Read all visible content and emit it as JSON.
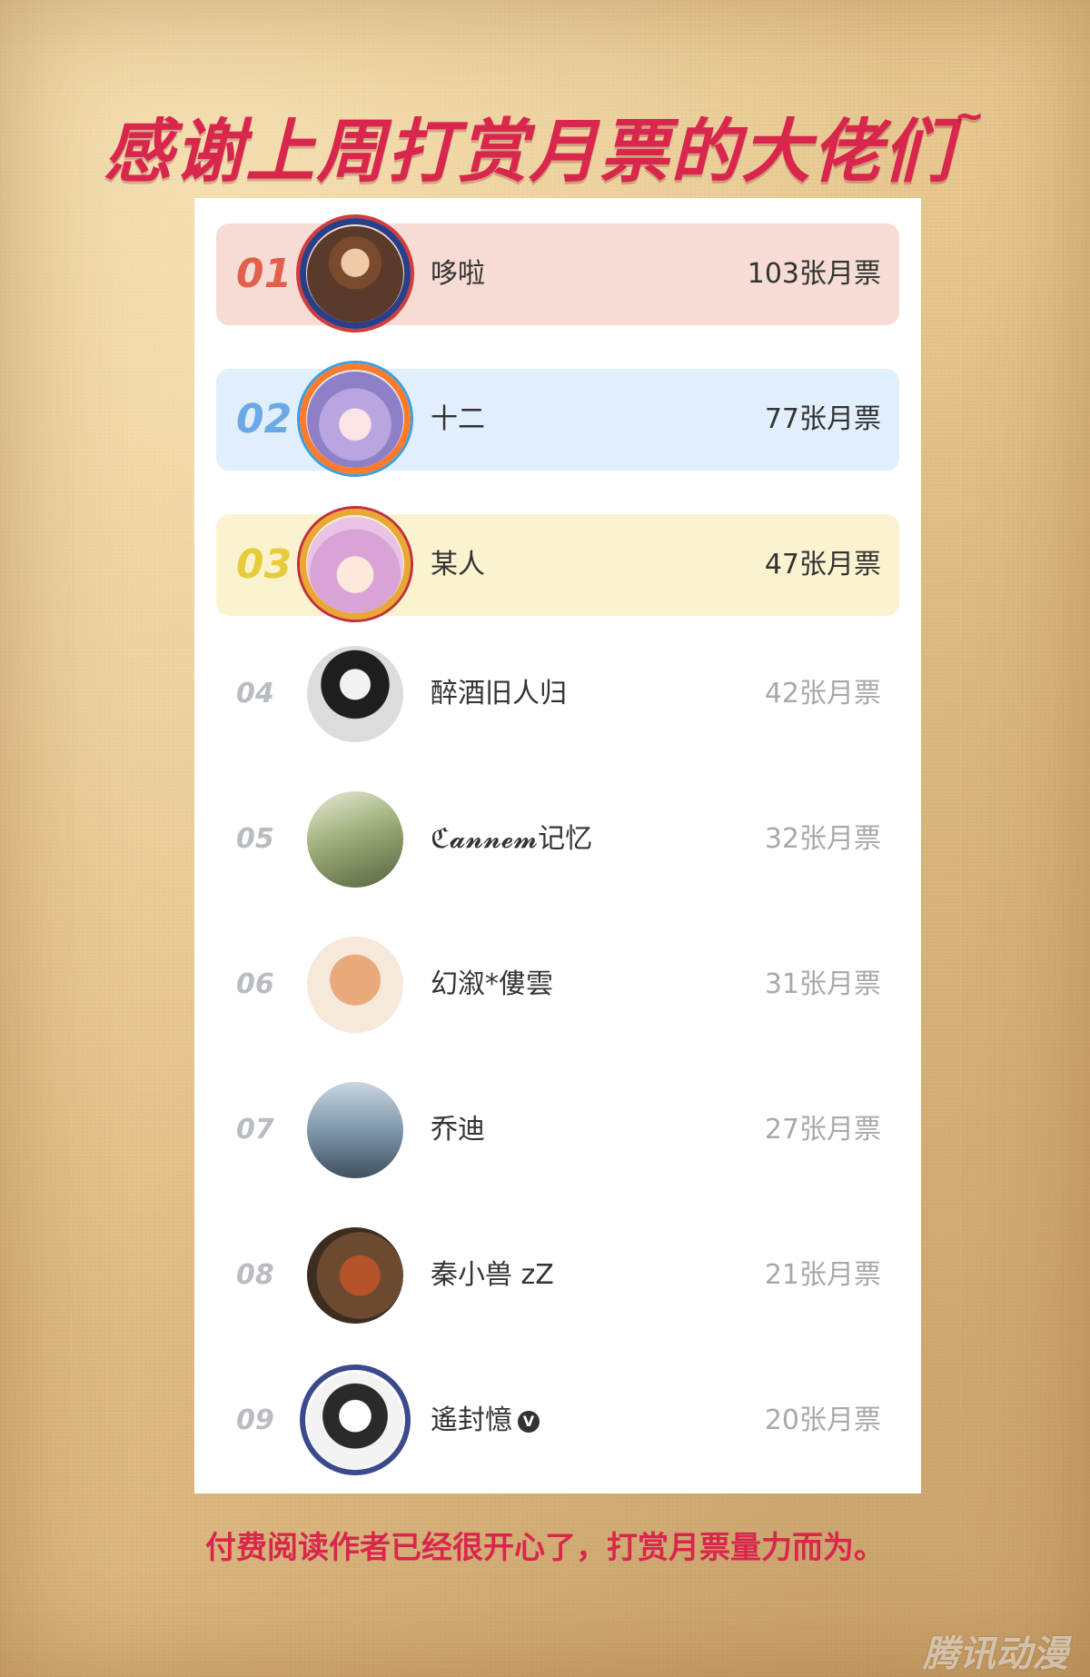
{
  "title": "感谢上周打赏月票的大佬们",
  "title_suffix": "~",
  "colors": {
    "title": "#d9264d",
    "rank1_bg": "#f6dcd4",
    "rank2_bg": "#e1eefc",
    "rank3_bg": "#fbf3cf"
  },
  "leaderboard": [
    {
      "rank": "01",
      "name": "哆啦",
      "tickets": "103张月票",
      "avatar": "portrait-avatar"
    },
    {
      "rank": "02",
      "name": "十二",
      "tickets": "77张月票",
      "avatar": "anime-girl-avatar"
    },
    {
      "rank": "03",
      "name": "某人",
      "tickets": "47张月票",
      "avatar": "anime-girl-avatar"
    },
    {
      "rank": "04",
      "name": "醉酒旧人归",
      "tickets": "42张月票",
      "avatar": "suited-man-avatar"
    },
    {
      "rank": "05",
      "name": "ℭ𝓪𝓷𝓷𝓮𝓶记忆",
      "tickets": "32张月票",
      "avatar": "landscape-avatar"
    },
    {
      "rank": "06",
      "name": "幻溆*僂雲",
      "tickets": "31张月票",
      "avatar": "cartoon-dog-avatar"
    },
    {
      "rank": "07",
      "name": "乔迪",
      "tickets": "27张月票",
      "avatar": "seaside-avatar"
    },
    {
      "rank": "08",
      "name": "秦小兽 zZ",
      "tickets": "21张月票",
      "avatar": "red-panda-avatar"
    },
    {
      "rank": "09",
      "name": "遙封憶",
      "tickets": "20张月票",
      "avatar": "masked-figure-avatar",
      "verified_mark": "V"
    }
  ],
  "footer": "付费阅读作者已经很开心了，打赏月票量力而为。",
  "watermark": "腾讯动漫"
}
